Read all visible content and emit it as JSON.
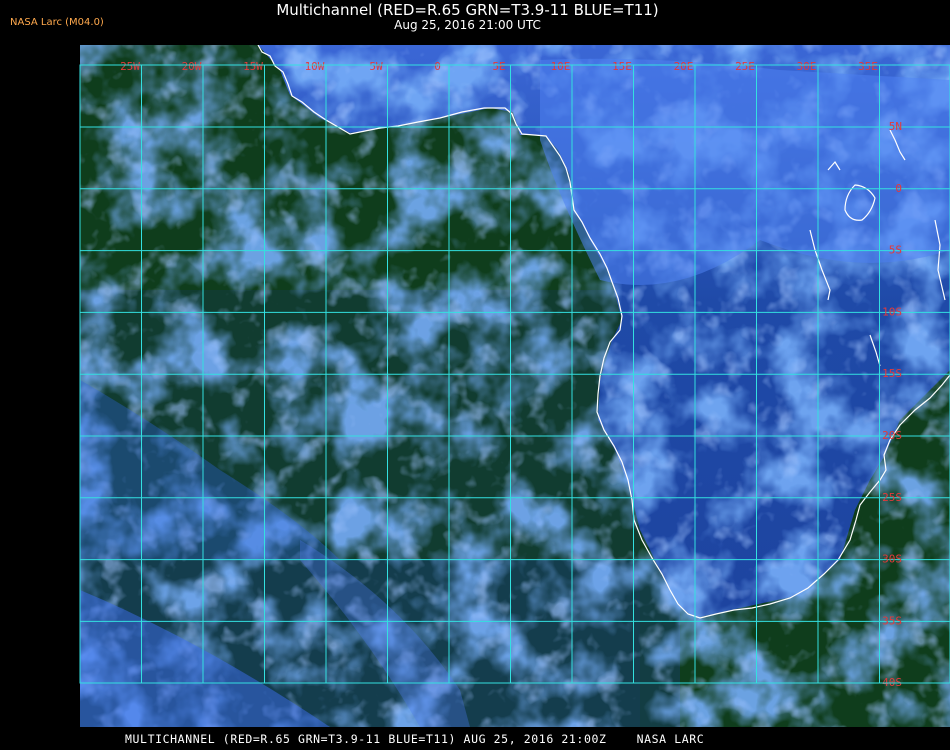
{
  "header": {
    "badge": "NASA Larc (M04.0)",
    "title_line1": "Multichannel (RED=R.65 GRN=T3.9-11 BLUE=T11)",
    "title_line2": "Aug 25, 2016 21:00 UTC"
  },
  "map": {
    "lon_labels": [
      "25W",
      "20W",
      "15W",
      "10W",
      "5W",
      "0",
      "5E",
      "10E",
      "15E",
      "20E",
      "25E",
      "30E",
      "35E"
    ],
    "lat_labels": [
      "5N",
      "0",
      "5S",
      "10S",
      "15S",
      "20S",
      "25S",
      "30S",
      "35S",
      "40S"
    ],
    "colors": {
      "ocean": "#0f3d1c",
      "cloud": "#2f6cf0",
      "grid": "#33e0e0",
      "label": "#e43a3a",
      "coast": "#ffffff"
    }
  },
  "footer": {
    "text": "MULTICHANNEL (RED=R.65 GRN=T3.9-11 BLUE=T11) AUG 25, 2016 21:00Z    NASA LARC"
  }
}
